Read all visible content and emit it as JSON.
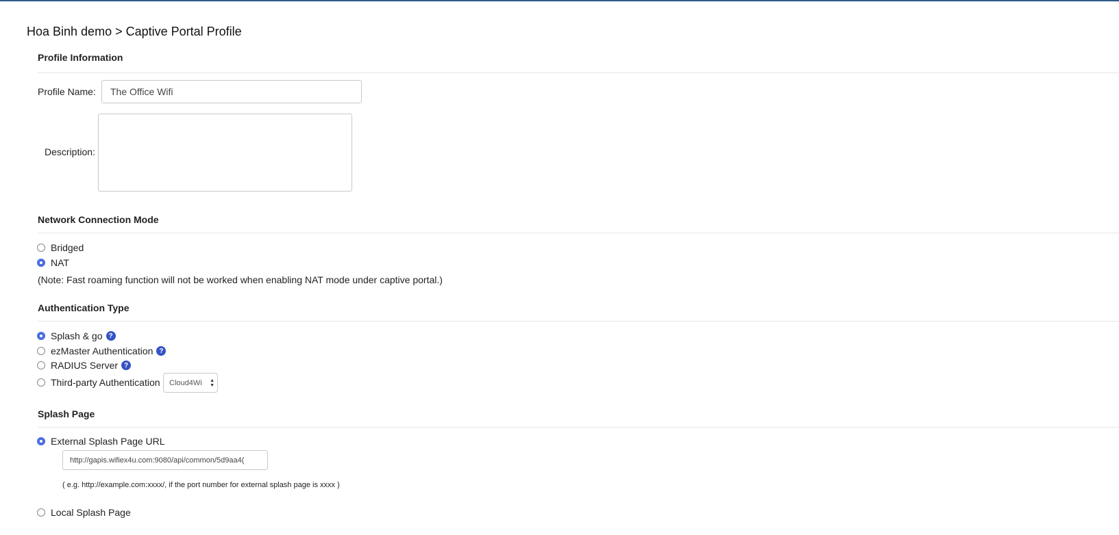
{
  "breadcrumb": "Hoa Binh demo > Captive Portal Profile",
  "profile_info": {
    "heading": "Profile Information",
    "name_label": "Profile Name:",
    "name_value": "The Office Wifi",
    "description_label": "Description:",
    "description_value": ""
  },
  "network_mode": {
    "heading": "Network Connection Mode",
    "options": [
      {
        "label": "Bridged",
        "checked": false
      },
      {
        "label": "NAT",
        "checked": true
      }
    ],
    "note": "(Note: Fast roaming function will not be worked when enabling NAT mode under captive portal.)"
  },
  "auth_type": {
    "heading": "Authentication Type",
    "options": [
      {
        "label": "Splash & go",
        "checked": true,
        "help": true
      },
      {
        "label": "ezMaster Authentication",
        "checked": false,
        "help": true
      },
      {
        "label": "RADIUS Server",
        "checked": false,
        "help": true
      },
      {
        "label": "Third-party Authentication",
        "checked": false,
        "help": false
      }
    ],
    "third_party_select": "Cloud4Wi",
    "help_glyph": "?"
  },
  "splash_page": {
    "heading": "Splash Page",
    "external_label": "External Splash Page URL",
    "external_checked": true,
    "external_url": "http://gapis.wifiex4u.com:9080/api/common/5d9aa4(",
    "example_note": "( e.g. http://example.com:xxxx/, if the port number for external splash page is xxxx )",
    "local_label": "Local Splash Page",
    "local_checked": false
  },
  "colors": {
    "accent": "#4a6ee0",
    "help_icon": "#3553c4",
    "top_border": "#2f5a8a"
  }
}
